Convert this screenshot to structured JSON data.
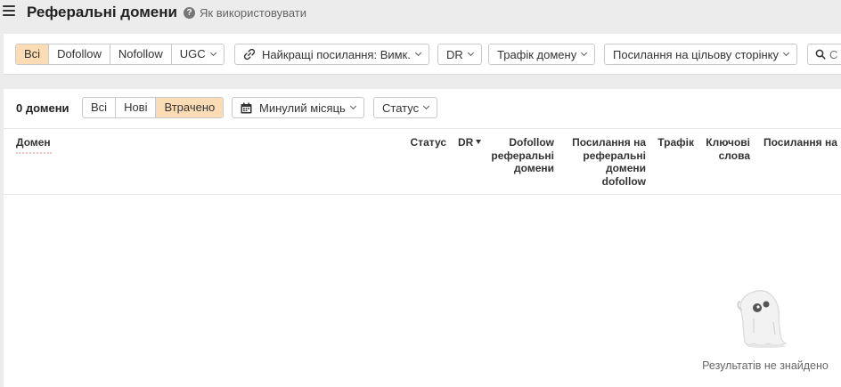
{
  "header": {
    "title": "Реферальні домени",
    "help_label": "Як використовувати"
  },
  "filters": {
    "link_type": [
      "Всі",
      "Dofollow",
      "Nofollow",
      "UGC"
    ],
    "best_links": "Найкращі посилання: Вимк.",
    "dr": "DR",
    "domain_traffic": "Трафік домену",
    "target_links": "Посилання на цільову сторінку",
    "search_placeholder": "С"
  },
  "panel": {
    "count": "0 домени",
    "status_tabs": [
      "Всі",
      "Нові",
      "Втрачено"
    ],
    "active_status_tab": "Втрачено",
    "period": "Минулий місяць",
    "status": "Статус"
  },
  "table": {
    "columns": {
      "domain": "Домен",
      "status": "Статус",
      "dr": "DR",
      "dofollow_ref_domains": "Dofollow реферальні домени",
      "links_to_ref_domains_dofollow": "Посилання на реферальні домени dofollow",
      "traffic": "Трафік",
      "keywords": "Ключові слова",
      "links_to": "Посилання на ц"
    }
  },
  "empty_state": {
    "message": "Результатів не знайдено"
  },
  "colors": {
    "active_segment": "#fcdcb5",
    "page_bg": "#ececec"
  }
}
